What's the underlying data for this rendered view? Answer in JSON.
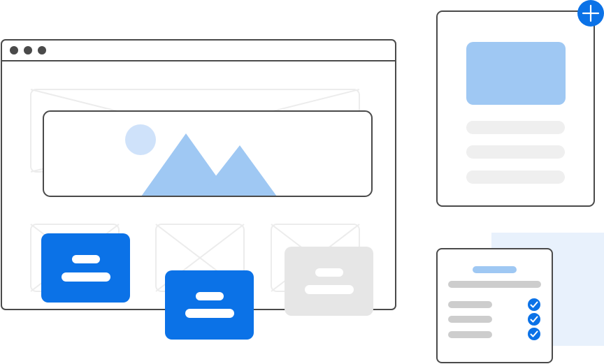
{
  "colors": {
    "outline": "#4a4a4a",
    "dot": "#4a4a4a",
    "primary": "#0b72e7",
    "light_blue": "#9fc8f3",
    "pale_blue": "#cfe2fa",
    "bg_blue": "#e8f1fc",
    "gray": "#e6e6e6",
    "gray_line": "#efefef",
    "mid_gray": "#cdcdcd",
    "wire": "#ececec",
    "white": "#ffffff"
  },
  "icons": {
    "window_dots": [
      "window-dot-icon",
      "window-dot-icon",
      "window-dot-icon"
    ],
    "add": "plus-icon",
    "image": "image-placeholder-icon",
    "check": "check-icon",
    "placeholder": "x-placeholder-icon"
  },
  "cards": [
    {
      "name": "blue-card-1",
      "style": "primary"
    },
    {
      "name": "blue-card-2",
      "style": "primary"
    },
    {
      "name": "gray-card",
      "style": "gray"
    }
  ],
  "checklist": {
    "items": [
      {
        "checked": true
      },
      {
        "checked": true
      },
      {
        "checked": true
      }
    ]
  }
}
